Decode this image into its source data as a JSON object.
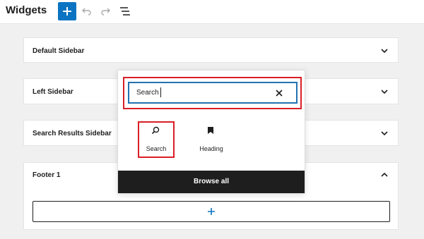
{
  "header": {
    "title": "Widgets",
    "add_icon": "plus-icon",
    "undo_icon": "undo-icon",
    "redo_icon": "redo-icon",
    "list_view_icon": "list-view-icon"
  },
  "panels": [
    {
      "label": "Default Sidebar",
      "state": "collapsed"
    },
    {
      "label": "Left Sidebar",
      "state": "collapsed"
    },
    {
      "label": "Search Results Sidebar",
      "state": "collapsed"
    },
    {
      "label": "Footer 1",
      "state": "expanded"
    }
  ],
  "inserter": {
    "search_value": "Search",
    "clear_icon": "close-icon",
    "results": [
      {
        "label": "Search",
        "icon": "search-icon"
      },
      {
        "label": "Heading",
        "icon": "bookmark-icon"
      }
    ],
    "browse_all_label": "Browse all"
  },
  "colors": {
    "accent": "#0a74c2",
    "highlight": "#d91f27",
    "focus": "#2271b1",
    "dark": "#1e1e1e"
  }
}
